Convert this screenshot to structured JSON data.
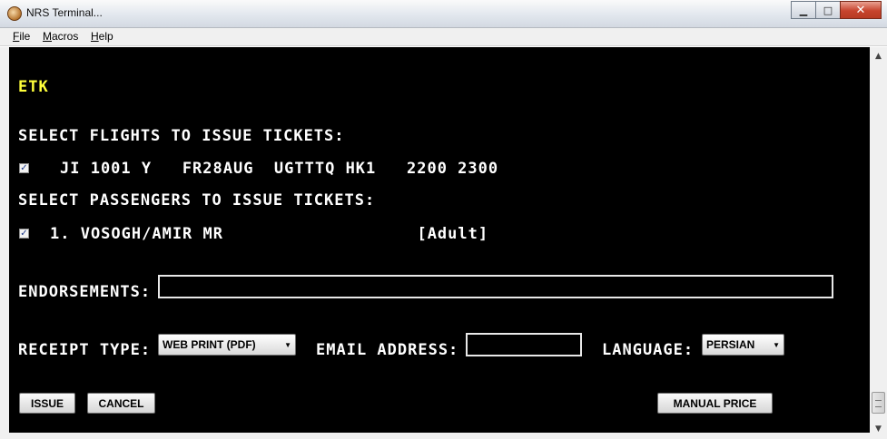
{
  "window": {
    "title": "NRS Terminal...",
    "minimize": "0",
    "maximize": "1",
    "close": "r"
  },
  "menu": [
    {
      "underline": "F",
      "rest": "ile"
    },
    {
      "underline": "M",
      "rest": "acros"
    },
    {
      "underline": "H",
      "rest": "elp"
    }
  ],
  "terminal": {
    "header": "ETK",
    "flights_heading": "SELECT FLIGHTS TO ISSUE TICKETS:",
    "flight_line": "JI 1001 Y   FR28AUG  UGTTTQ HK1   2200 2300",
    "flight_checked": true,
    "passengers_heading": "SELECT PASSENGERS TO ISSUE TICKETS:",
    "passenger_line": "1. VOSOGH/AMIR MR                   [Adult]",
    "passenger_checked": true,
    "endorsements_label": "ENDORSEMENTS:",
    "endorsements_value": "",
    "receipt_type_label": "RECEIPT TYPE:",
    "receipt_type_value": "WEB PRINT (PDF)",
    "email_label": "EMAIL ADDRESS:",
    "email_value": "",
    "language_label": "LANGUAGE:",
    "language_value": "PERSIAN",
    "issue_button": "ISSUE",
    "cancel_button": "CANCEL",
    "manual_price_button": "MANUAL PRICE"
  },
  "check_glyph": "✓"
}
